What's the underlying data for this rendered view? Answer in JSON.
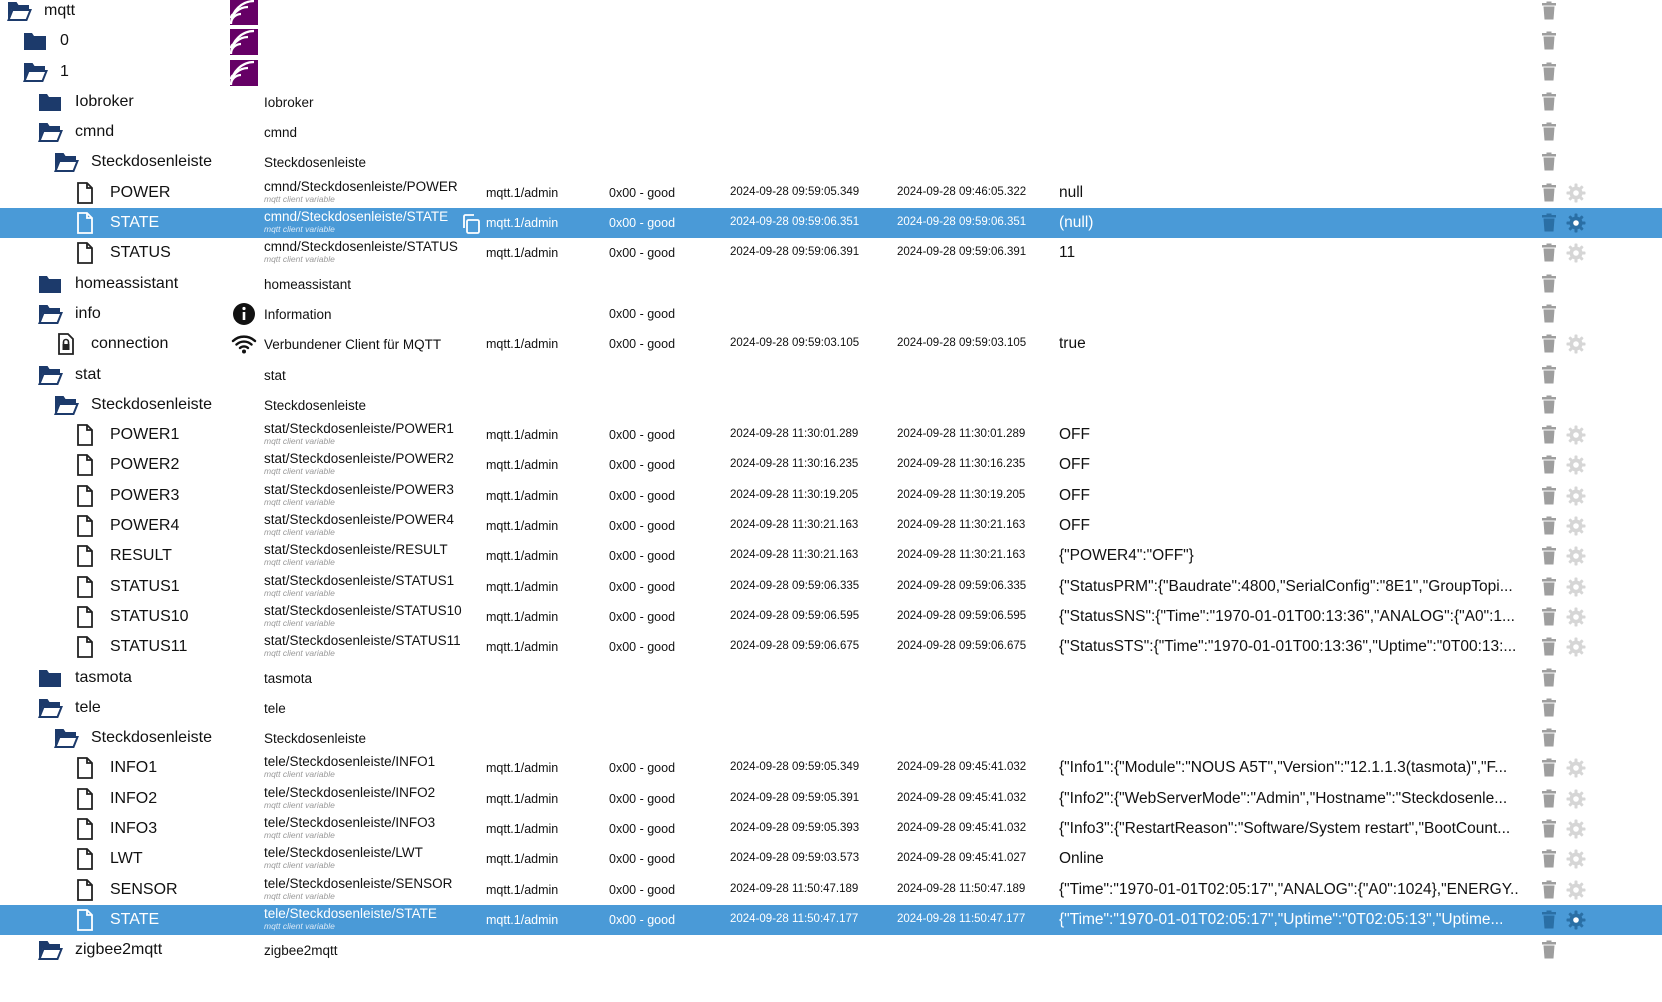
{
  "colors": {
    "selected_row": "#4a9ad7",
    "folder": "#1c3a6b",
    "mqtt_logo": "#660066",
    "icon_gray": "#9e9e9e"
  },
  "rows": [
    {
      "name": "mqtt",
      "type": "folder-open",
      "level": 0,
      "ts_icon": "mqtt-logo",
      "trash": true
    },
    {
      "name": "0",
      "type": "folder",
      "level": 1,
      "ts_icon": "mqtt-logo",
      "trash": true
    },
    {
      "name": "1",
      "type": "folder-open",
      "level": 1,
      "ts_icon": "mqtt-logo",
      "trash": true
    },
    {
      "name": "Iobroker",
      "type": "folder",
      "level": 2,
      "plain": "Iobroker",
      "trash": true
    },
    {
      "name": "cmnd",
      "type": "folder-open",
      "level": 2,
      "plain": "cmnd",
      "trash": true
    },
    {
      "name": "Steckdosenleiste",
      "type": "folder-open",
      "level": 3,
      "plain": "Steckdosenleiste",
      "trash": true
    },
    {
      "name": "POWER",
      "type": "file",
      "level": 4,
      "id": "cmnd/Steckdosenleiste/POWER",
      "sub": "mqtt client variable",
      "role": "mqtt.1/admin",
      "qual": "0x00 - good",
      "ts": "2024-09-28 09:59:05.349",
      "lc": "2024-09-28 09:46:05.322",
      "val": "null",
      "trash": true,
      "gear": true
    },
    {
      "name": "STATE",
      "type": "file",
      "level": 4,
      "id": "cmnd/Steckdosenleiste/STATE",
      "sub": "mqtt client variable",
      "role": "mqtt.1/admin",
      "qual": "0x00 - good",
      "ts": "2024-09-28 09:59:06.351",
      "lc": "2024-09-28 09:59:06.351",
      "val": "(null)",
      "trash": true,
      "gear": true,
      "selected": true,
      "copy": true
    },
    {
      "name": "STATUS",
      "type": "file",
      "level": 4,
      "id": "cmnd/Steckdosenleiste/STATUS",
      "sub": "mqtt client variable",
      "role": "mqtt.1/admin",
      "qual": "0x00 - good",
      "ts": "2024-09-28 09:59:06.391",
      "lc": "2024-09-28 09:59:06.391",
      "val": "11",
      "trash": true,
      "gear": true
    },
    {
      "name": "homeassistant",
      "type": "folder",
      "level": 2,
      "plain": "homeassistant",
      "trash": true
    },
    {
      "name": "info",
      "type": "folder-open",
      "level": 2,
      "plain": "Information",
      "ts_icon": "info-circle",
      "qual": "0x00 - good",
      "trash": true
    },
    {
      "name": "connection",
      "type": "state-lock",
      "level": 3,
      "plain": "Verbundener Client für MQTT",
      "ts_icon": "wifi",
      "role": "mqtt.1/admin",
      "qual": "0x00 - good",
      "ts": "2024-09-28 09:59:03.105",
      "lc": "2024-09-28 09:59:03.105",
      "val": "true",
      "trash": true,
      "gear": true
    },
    {
      "name": "stat",
      "type": "folder-open",
      "level": 2,
      "plain": "stat",
      "trash": true
    },
    {
      "name": "Steckdosenleiste",
      "type": "folder-open",
      "level": 3,
      "plain": "Steckdosenleiste",
      "trash": true
    },
    {
      "name": "POWER1",
      "type": "file",
      "level": 4,
      "id": "stat/Steckdosenleiste/POWER1",
      "sub": "mqtt client variable",
      "role": "mqtt.1/admin",
      "qual": "0x00 - good",
      "ts": "2024-09-28 11:30:01.289",
      "lc": "2024-09-28 11:30:01.289",
      "val": "OFF",
      "trash": true,
      "gear": true
    },
    {
      "name": "POWER2",
      "type": "file",
      "level": 4,
      "id": "stat/Steckdosenleiste/POWER2",
      "sub": "mqtt client variable",
      "role": "mqtt.1/admin",
      "qual": "0x00 - good",
      "ts": "2024-09-28 11:30:16.235",
      "lc": "2024-09-28 11:30:16.235",
      "val": "OFF",
      "trash": true,
      "gear": true
    },
    {
      "name": "POWER3",
      "type": "file",
      "level": 4,
      "id": "stat/Steckdosenleiste/POWER3",
      "sub": "mqtt client variable",
      "role": "mqtt.1/admin",
      "qual": "0x00 - good",
      "ts": "2024-09-28 11:30:19.205",
      "lc": "2024-09-28 11:30:19.205",
      "val": "OFF",
      "trash": true,
      "gear": true
    },
    {
      "name": "POWER4",
      "type": "file",
      "level": 4,
      "id": "stat/Steckdosenleiste/POWER4",
      "sub": "mqtt client variable",
      "role": "mqtt.1/admin",
      "qual": "0x00 - good",
      "ts": "2024-09-28 11:30:21.163",
      "lc": "2024-09-28 11:30:21.163",
      "val": "OFF",
      "trash": true,
      "gear": true
    },
    {
      "name": "RESULT",
      "type": "file",
      "level": 4,
      "id": "stat/Steckdosenleiste/RESULT",
      "sub": "mqtt client variable",
      "role": "mqtt.1/admin",
      "qual": "0x00 - good",
      "ts": "2024-09-28 11:30:21.163",
      "lc": "2024-09-28 11:30:21.163",
      "val": "{\"POWER4\":\"OFF\"}",
      "trash": true,
      "gear": true
    },
    {
      "name": "STATUS1",
      "type": "file",
      "level": 4,
      "id": "stat/Steckdosenleiste/STATUS1",
      "sub": "mqtt client variable",
      "role": "mqtt.1/admin",
      "qual": "0x00 - good",
      "ts": "2024-09-28 09:59:06.335",
      "lc": "2024-09-28 09:59:06.335",
      "val": "{\"StatusPRM\":{\"Baudrate\":4800,\"SerialConfig\":\"8E1\",\"GroupTopi...",
      "trash": true,
      "gear": true
    },
    {
      "name": "STATUS10",
      "type": "file",
      "level": 4,
      "id": "stat/Steckdosenleiste/STATUS10",
      "sub": "mqtt client variable",
      "role": "mqtt.1/admin",
      "qual": "0x00 - good",
      "ts": "2024-09-28 09:59:06.595",
      "lc": "2024-09-28 09:59:06.595",
      "val": "{\"StatusSNS\":{\"Time\":\"1970-01-01T00:13:36\",\"ANALOG\":{\"A0\":1...",
      "trash": true,
      "gear": true
    },
    {
      "name": "STATUS11",
      "type": "file",
      "level": 4,
      "id": "stat/Steckdosenleiste/STATUS11",
      "sub": "mqtt client variable",
      "role": "mqtt.1/admin",
      "qual": "0x00 - good",
      "ts": "2024-09-28 09:59:06.675",
      "lc": "2024-09-28 09:59:06.675",
      "val": "{\"StatusSTS\":{\"Time\":\"1970-01-01T00:13:36\",\"Uptime\":\"0T00:13:...",
      "trash": true,
      "gear": true
    },
    {
      "name": "tasmota",
      "type": "folder",
      "level": 2,
      "plain": "tasmota",
      "trash": true
    },
    {
      "name": "tele",
      "type": "folder-open",
      "level": 2,
      "plain": "tele",
      "trash": true
    },
    {
      "name": "Steckdosenleiste",
      "type": "folder-open",
      "level": 3,
      "plain": "Steckdosenleiste",
      "trash": true
    },
    {
      "name": "INFO1",
      "type": "file",
      "level": 4,
      "id": "tele/Steckdosenleiste/INFO1",
      "sub": "mqtt client variable",
      "role": "mqtt.1/admin",
      "qual": "0x00 - good",
      "ts": "2024-09-28 09:59:05.349",
      "lc": "2024-09-28 09:45:41.032",
      "val": "{\"Info1\":{\"Module\":\"NOUS A5T\",\"Version\":\"12.1.1.3(tasmota)\",\"F...",
      "trash": true,
      "gear": true
    },
    {
      "name": "INFO2",
      "type": "file",
      "level": 4,
      "id": "tele/Steckdosenleiste/INFO2",
      "sub": "mqtt client variable",
      "role": "mqtt.1/admin",
      "qual": "0x00 - good",
      "ts": "2024-09-28 09:59:05.391",
      "lc": "2024-09-28 09:45:41.032",
      "val": "{\"Info2\":{\"WebServerMode\":\"Admin\",\"Hostname\":\"Steckdosenle...",
      "trash": true,
      "gear": true
    },
    {
      "name": "INFO3",
      "type": "file",
      "level": 4,
      "id": "tele/Steckdosenleiste/INFO3",
      "sub": "mqtt client variable",
      "role": "mqtt.1/admin",
      "qual": "0x00 - good",
      "ts": "2024-09-28 09:59:05.393",
      "lc": "2024-09-28 09:45:41.032",
      "val": "{\"Info3\":{\"RestartReason\":\"Software/System restart\",\"BootCount...",
      "trash": true,
      "gear": true
    },
    {
      "name": "LWT",
      "type": "file",
      "level": 4,
      "id": "tele/Steckdosenleiste/LWT",
      "sub": "mqtt client variable",
      "role": "mqtt.1/admin",
      "qual": "0x00 - good",
      "ts": "2024-09-28 09:59:03.573",
      "lc": "2024-09-28 09:45:41.027",
      "val": "Online",
      "trash": true,
      "gear": true
    },
    {
      "name": "SENSOR",
      "type": "file",
      "level": 4,
      "id": "tele/Steckdosenleiste/SENSOR",
      "sub": "mqtt client variable",
      "role": "mqtt.1/admin",
      "qual": "0x00 - good",
      "ts": "2024-09-28 11:50:47.189",
      "lc": "2024-09-28 11:50:47.189",
      "val": "{\"Time\":\"1970-01-01T02:05:17\",\"ANALOG\":{\"A0\":1024},\"ENERGY...",
      "trash": true,
      "gear": true
    },
    {
      "name": "STATE",
      "type": "file",
      "level": 4,
      "id": "tele/Steckdosenleiste/STATE",
      "sub": "mqtt client variable",
      "role": "mqtt.1/admin",
      "qual": "0x00 - good",
      "ts": "2024-09-28 11:50:47.177",
      "lc": "2024-09-28 11:50:47.177",
      "val": "{\"Time\":\"1970-01-01T02:05:17\",\"Uptime\":\"0T02:05:13\",\"Uptime...",
      "trash": true,
      "gear": true,
      "selected": true
    },
    {
      "name": "zigbee2mqtt",
      "type": "folder-open",
      "level": 2,
      "plain": "zigbee2mqtt",
      "trash": true
    }
  ]
}
